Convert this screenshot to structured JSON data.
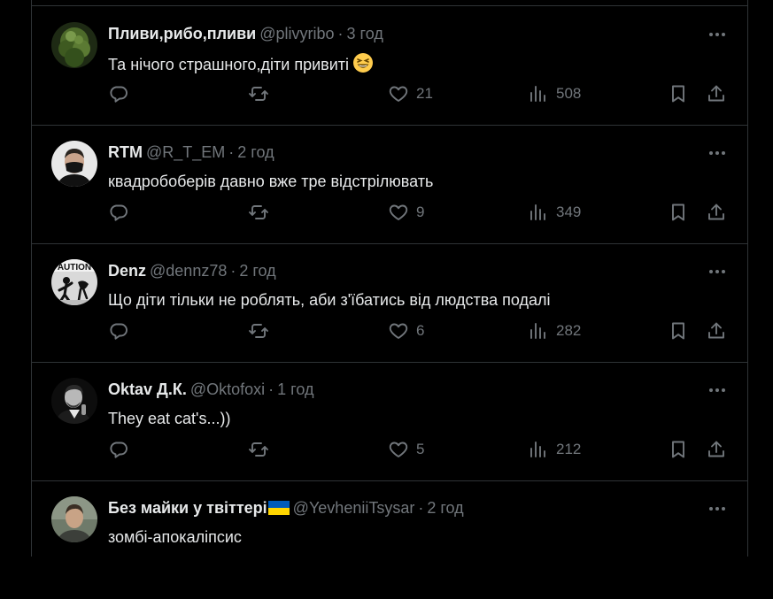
{
  "tweets": [
    {
      "name": "Пливи,рибо,пливи",
      "handle": "@plivyribo",
      "time": "3 год",
      "text": "Та нічого страшного,діти привиті",
      "emoji": "grinning-squinting-face",
      "avatar": "green-leaves-avatar",
      "replies": "",
      "retweets": "",
      "likes": "21",
      "views": "508"
    },
    {
      "name": "RTM",
      "handle": "@R_T_EM",
      "time": "2 год",
      "text": "квадробоберів давно вже тре відстрілювать",
      "avatar": "masked-man-avatar",
      "replies": "",
      "retweets": "",
      "likes": "9",
      "views": "349"
    },
    {
      "name": "Denz",
      "handle": "@dennz78",
      "time": "2 год",
      "text": "Що діти тільки не роблять, аби з'їбатись від людства подалі",
      "avatar": "caution-sign-avatar",
      "avatar_text": "AUTION",
      "replies": "",
      "retweets": "",
      "likes": "6",
      "views": "282"
    },
    {
      "name": "Oktav Д.К.",
      "handle": "@Oktofoxi",
      "time": "1 год",
      "text": "They eat cat's...))",
      "avatar": "bw-portrait-avatar",
      "replies": "",
      "retweets": "",
      "likes": "5",
      "views": "212"
    },
    {
      "name": "Без майки у твіттері",
      "handle": "@YevheniiTsysar",
      "time": "2 год",
      "text": "зомбі-апокаліпсис",
      "flag_colors": [
        "#005bbb",
        "#ffd500"
      ],
      "avatar": "man-in-grey-avatar"
    }
  ],
  "icons": {
    "reply": "reply-icon",
    "retweet": "retweet-icon",
    "like": "heart-icon",
    "views": "views-chart-icon",
    "bookmark": "bookmark-icon",
    "share": "share-icon",
    "more": "more-dots-icon"
  },
  "colors": {
    "background": "#000000",
    "text": "#e7e9ea",
    "muted": "#71767b",
    "border": "#2f3336"
  }
}
